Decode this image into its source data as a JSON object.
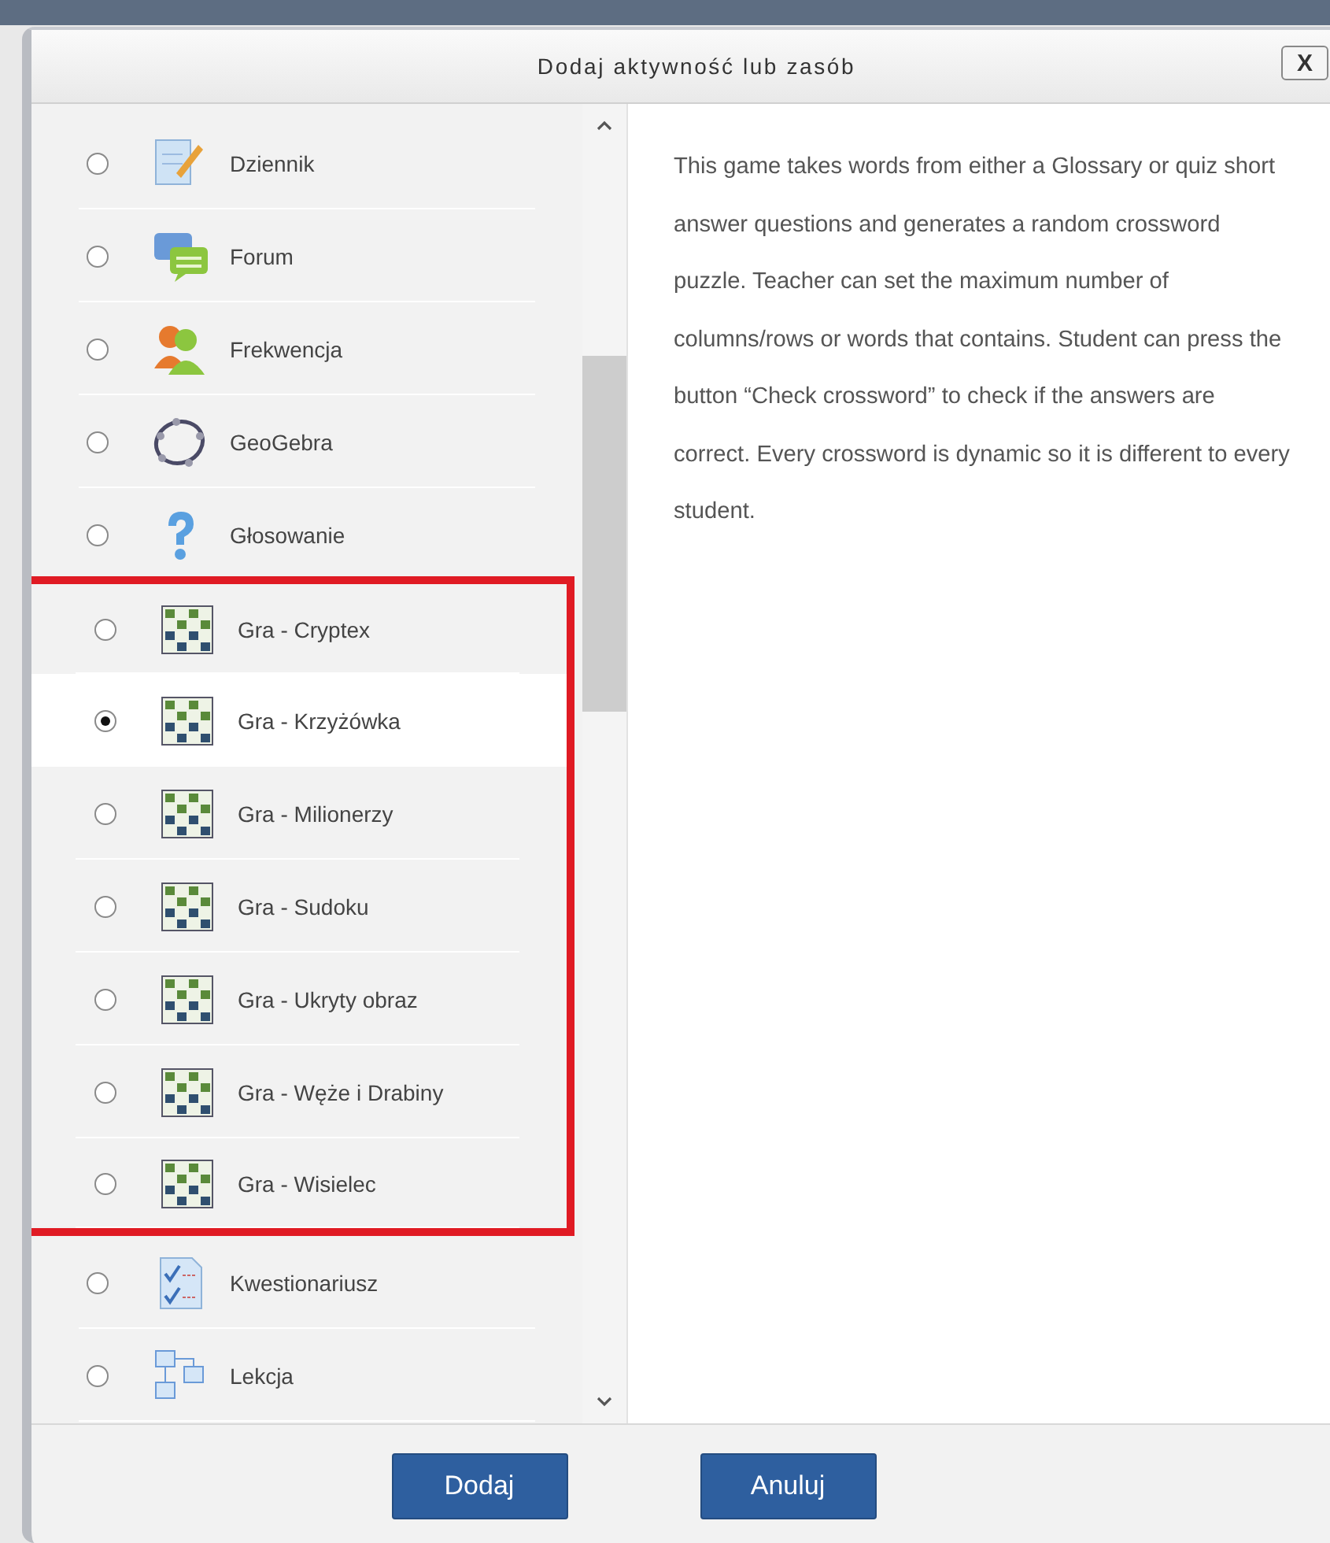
{
  "dialog": {
    "title": "Dodaj aktywność lub zasób",
    "close": "X"
  },
  "items": [
    {
      "label": "Dziennik",
      "kind": "journal",
      "selected": false,
      "highlighted": false
    },
    {
      "label": "Forum",
      "kind": "forum",
      "selected": false,
      "highlighted": false
    },
    {
      "label": "Frekwencja",
      "kind": "attendance",
      "selected": false,
      "highlighted": false
    },
    {
      "label": "GeoGebra",
      "kind": "geogebra",
      "selected": false,
      "highlighted": false
    },
    {
      "label": "Głosowanie",
      "kind": "poll",
      "selected": false,
      "highlighted": false
    },
    {
      "label": "Gra - Cryptex",
      "kind": "game",
      "selected": false,
      "highlighted": true
    },
    {
      "label": "Gra - Krzyżówka",
      "kind": "game",
      "selected": true,
      "highlighted": true
    },
    {
      "label": "Gra - Milionerzy",
      "kind": "game",
      "selected": false,
      "highlighted": true
    },
    {
      "label": "Gra - Sudoku",
      "kind": "game",
      "selected": false,
      "highlighted": true
    },
    {
      "label": "Gra - Ukryty obraz",
      "kind": "game",
      "selected": false,
      "highlighted": true
    },
    {
      "label": "Gra - Węże i Drabiny",
      "kind": "game",
      "selected": false,
      "highlighted": true
    },
    {
      "label": "Gra - Wisielec",
      "kind": "game",
      "selected": false,
      "highlighted": true
    },
    {
      "label": "Kwestionariusz",
      "kind": "questionnaire",
      "selected": false,
      "highlighted": false
    },
    {
      "label": "Lekcja",
      "kind": "lesson",
      "selected": false,
      "highlighted": false
    }
  ],
  "description": "This game takes words from either a Glossary or quiz short answer questions and generates a random crossword puzzle. Teacher can set the maximum number of columns/rows or words that contains. Student can press the button “Check crossword” to check if the answers are correct. Every crossword is dynamic so it is different to every student.",
  "buttons": [
    "Dodaj",
    "Anuluj"
  ]
}
